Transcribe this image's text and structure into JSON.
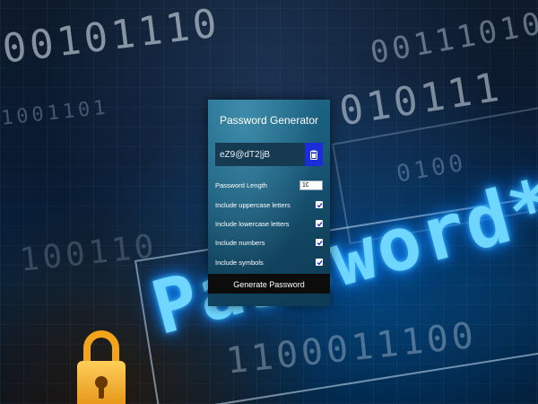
{
  "background": {
    "binary_rows": [
      "00101110",
      "00111010",
      "010111",
      "1001101",
      "100110",
      "1100011100",
      "0100"
    ],
    "hero_text": "Password***",
    "accent_color": "#6fd6ff",
    "lock_color": "#f2a51a"
  },
  "card": {
    "title": "Password Generator",
    "result": "eZ9@dT2|jB",
    "copy_icon": "clipboard-icon",
    "settings": {
      "length_label": "Password Length",
      "length_value": "10",
      "uppercase_label": "Include uppercase letters",
      "lowercase_label": "Include lowercase letters",
      "numbers_label": "Include numbers",
      "symbols_label": "Include symbols",
      "uppercase_checked": true,
      "lowercase_checked": true,
      "numbers_checked": true,
      "symbols_checked": true
    },
    "generate_label": "Generate Password",
    "colors": {
      "copy_button": "#1a2dd8",
      "generate_button": "#0c0c0c",
      "check": "#1a2dd8"
    }
  }
}
